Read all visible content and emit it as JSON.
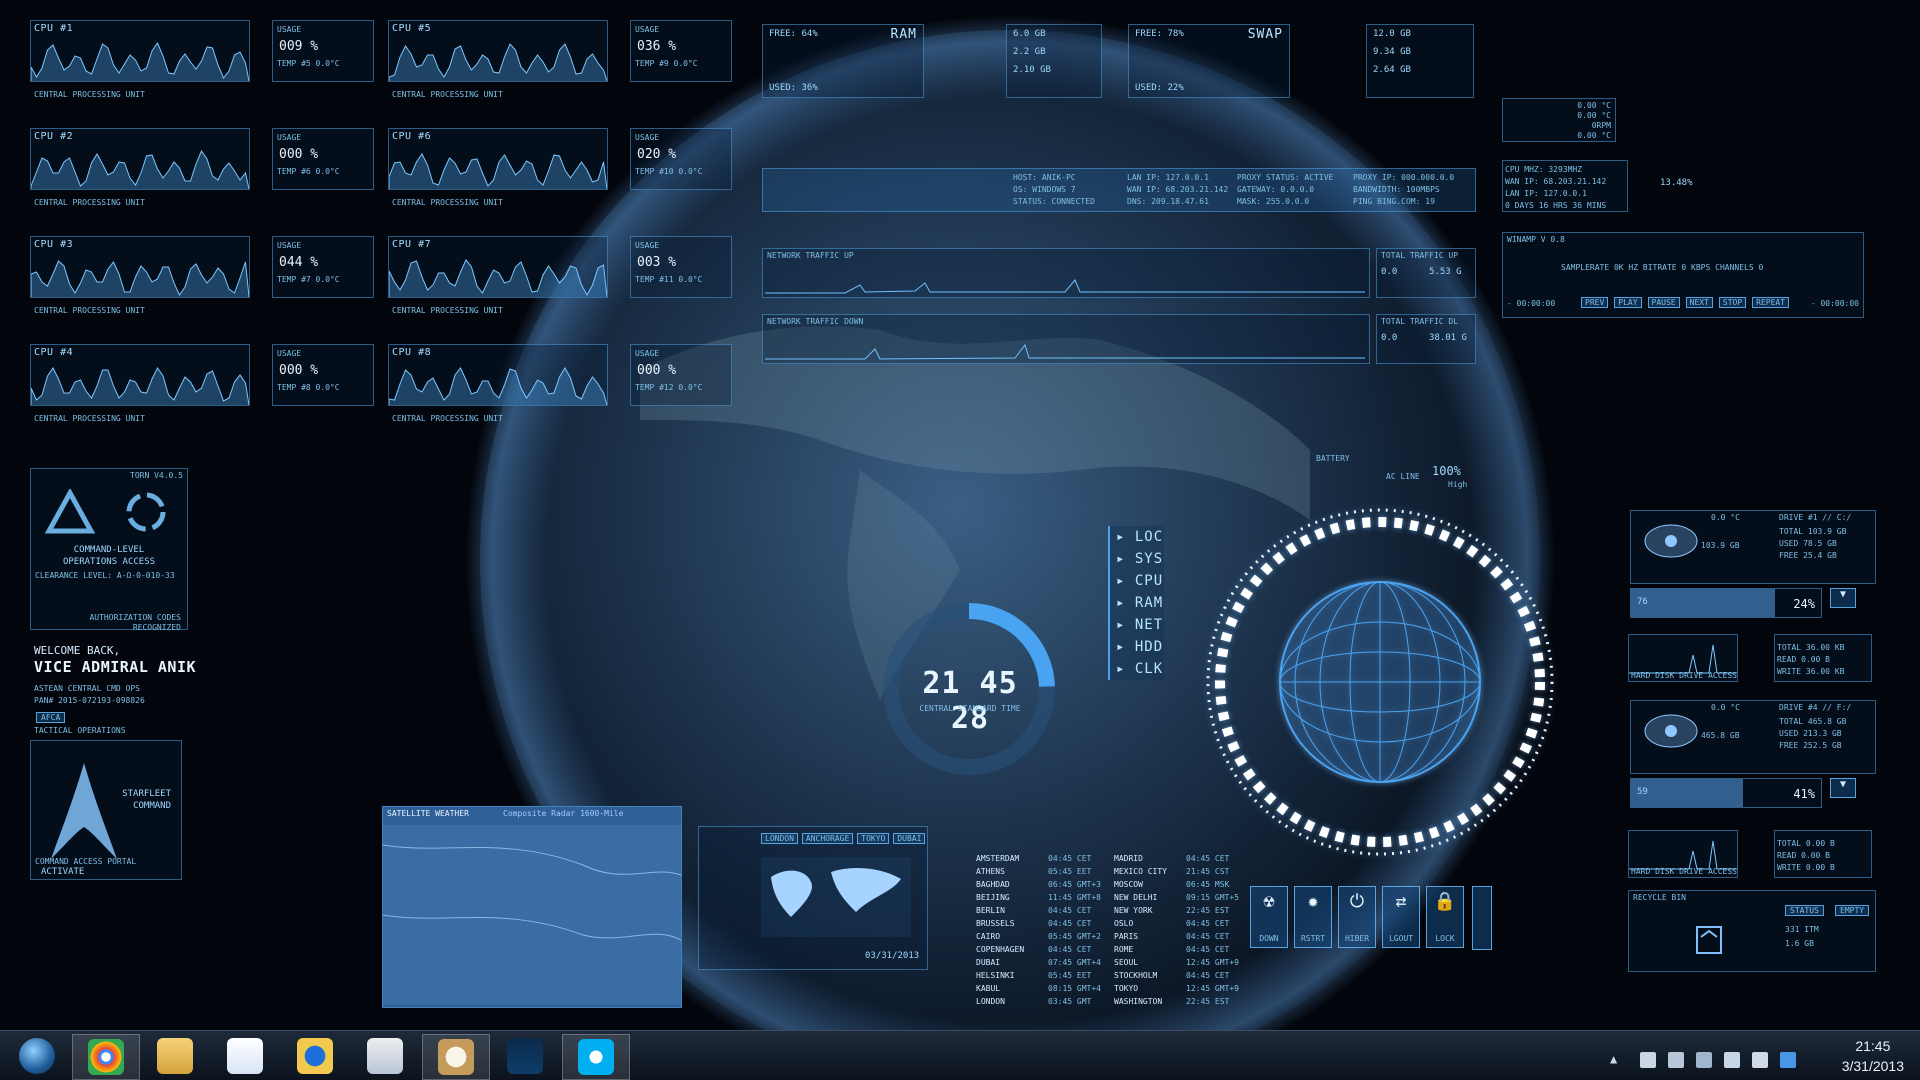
{
  "cpu_tiles": [
    {
      "title": "CPU #1",
      "usage": "009 %",
      "temp": "TEMP #5  0.0°C",
      "footer": "CENTRAL PROCESSING UNIT"
    },
    {
      "title": "CPU #5",
      "usage": "036 %",
      "temp": "TEMP #9  0.0°C",
      "footer": "CENTRAL PROCESSING UNIT"
    },
    {
      "title": "CPU #2",
      "usage": "000 %",
      "temp": "TEMP #6  0.0°C",
      "footer": "CENTRAL PROCESSING UNIT"
    },
    {
      "title": "CPU #6",
      "usage": "020 %",
      "temp": "TEMP #10 0.0°C",
      "footer": "CENTRAL PROCESSING UNIT"
    },
    {
      "title": "CPU #3",
      "usage": "044 %",
      "temp": "TEMP #7  0.0°C",
      "footer": "CENTRAL PROCESSING UNIT"
    },
    {
      "title": "CPU #7",
      "usage": "003 %",
      "temp": "TEMP #11 0.0°C",
      "footer": "CENTRAL PROCESSING UNIT"
    },
    {
      "title": "CPU #4",
      "usage": "000 %",
      "temp": "TEMP #8  0.0°C",
      "footer": "CENTRAL PROCESSING UNIT"
    },
    {
      "title": "CPU #8",
      "usage": "000 %",
      "temp": "TEMP #12 0.0°C",
      "footer": "CENTRAL PROCESSING UNIT"
    }
  ],
  "ram": {
    "title": "RAM",
    "free": "FREE: 64%",
    "used": "USED: 36%",
    "rows": [
      "6.0 GB",
      "2.2 GB",
      "2.10 GB"
    ]
  },
  "swap": {
    "title": "SWAP",
    "free": "FREE: 78%",
    "used": "USED: 22%",
    "rows": [
      "12.0 GB",
      "9.34 GB",
      "2.64 GB"
    ]
  },
  "host": {
    "col1": [
      "HOST: ANIK-PC",
      "OS: WINDOWS 7",
      "STATUS: CONNECTED"
    ],
    "col2": [
      "LAN IP: 127.0.0.1",
      "WAN IP: 68.203.21.142",
      "DNS: 209.18.47.61"
    ],
    "col3": [
      "PROXY STATUS: ACTIVE",
      "GATEWAY: 0.0.0.0",
      "MASK: 255.0.0.0"
    ],
    "col4": [
      "PROXY IP: 000.000.0.0",
      "BANDWIDTH: 100MBPS",
      "PING BING.COM: 19"
    ]
  },
  "net_up": {
    "title": "NETWORK TRAFFIC UP",
    "total_label": "TOTAL TRAFFIC UP",
    "a": "0.0",
    "b": "5.53 G"
  },
  "net_down": {
    "title": "NETWORK TRAFFIC DOWN",
    "total_label": "TOTAL TRAFFIC DL",
    "a": "0.0",
    "b": "38.01 G"
  },
  "left_panel": {
    "version": "TORN V4.0.5",
    "cmd_title": "COMMAND-LEVEL",
    "cmd_sub": "OPERATIONS ACCESS",
    "clearance": "CLEARANCE LEVEL: A-Ω-0-010-33",
    "auth1": "AUTHORIZATION CODES",
    "auth2": "RECOGNIZED",
    "welcome": "WELCOME BACK,",
    "name": "VICE ADMIRAL ANIK",
    "org": "ASTEAN CENTRAL CMD OPS",
    "pan": "PAN# 2015-072193-098826",
    "afca": "AFCA",
    "tactical": "TACTICAL OPERATIONS",
    "starfleet1": "STARFLEET",
    "starfleet2": "COMMAND",
    "portal": "COMMAND ACCESS PORTAL",
    "activate": "ACTIVATE"
  },
  "clock": {
    "time": "21 45 28",
    "zone": "CENTRAL STANDARD TIME"
  },
  "menu": [
    "LOC",
    "SYS",
    "CPU",
    "RAM",
    "NET",
    "HDD",
    "CLK"
  ],
  "battery": {
    "label": "BATTERY",
    "ac": "AC LINE",
    "pct": "100%",
    "state": "High"
  },
  "weather": {
    "title": "SATELLITE WEATHER",
    "radar": "Composite Radar 1600-Mile"
  },
  "world_clock": {
    "cities_1": [
      "AMSTERDAM",
      "ATHENS",
      "BAGHDAD",
      "BEIJING",
      "BERLIN",
      "BRUSSELS",
      "CAIRO",
      "COPENHAGEN",
      "DUBAI",
      "HELSINKI",
      "KABUL",
      "LONDON"
    ],
    "times_1": [
      "04:45 CET",
      "05:45 EET",
      "06:45 GMT+3",
      "11:45 GMT+8",
      "04:45 CET",
      "04:45 CET",
      "05:45 GMT+2",
      "04:45 CET",
      "07:45 GMT+4",
      "05:45 EET",
      "08:15 GMT+4",
      "03:45 GMT"
    ],
    "cities_2": [
      "MADRID",
      "MEXICO CITY",
      "MOSCOW",
      "NEW DELHI",
      "NEW YORK",
      "OSLO",
      "PARIS",
      "ROME",
      "SEOUL",
      "STOCKHOLM",
      "TOKYO",
      "WASHINGTON"
    ],
    "times_2": [
      "04:45 CET",
      "21:45 CST",
      "06:45 MSK",
      "09:15 GMT+5",
      "22:45 EST",
      "04:45 CET",
      "04:45 CET",
      "04:45 CET",
      "12:45 GMT+9",
      "04:45 CET",
      "12:45 GMT+9",
      "22:45 EST"
    ],
    "date": "03/31/2013",
    "tabs": [
      "LONDON",
      "ANCHORAGE",
      "TOKYO",
      "DUBAI"
    ]
  },
  "power_buttons": [
    "DOWN",
    "RSTRT",
    "HIBER",
    "LGOUT",
    "LOCK"
  ],
  "right_sys": {
    "cpu": "0.00 °C",
    "gpu": "0.00 °C",
    "fan": "0RPM",
    "hdd": "0.00 °C",
    "cpu_mhz": "CPU MHZ: 3293MHZ",
    "wan": "WAN IP: 68.203.21.142",
    "lan": "LAN IP: 127.0.0.1",
    "uptime": "0 DAYS 16 HRS 36 MINS",
    "cpu_pct": "13.48%",
    "winamp": "WINAMP V 0.8",
    "samplerate": "SAMPLERATE  0K HZ   BITRATE  0 KBPS   CHANNELS  0",
    "time_a": "- 00:00:00",
    "time_b": "- 00:00:00",
    "ctrls": [
      "PREV",
      "PLAY",
      "PAUSE",
      "NEXT",
      "STOP",
      "REPEAT"
    ]
  },
  "drives": [
    {
      "label": "DRIVE #1 // C:/",
      "total": "TOTAL 103.9 GB",
      "used": "USED 78.5 GB",
      "free": "FREE 25.4 GB",
      "bar": "76",
      "pct": "24%",
      "status": "0.0 °C",
      "size": "103.9 GB"
    },
    {
      "label": "DRIVE #4 // F:/",
      "total": "TOTAL 465.8 GB",
      "used": "USED 213.3 GB",
      "free": "FREE 252.5 GB",
      "bar": "59",
      "pct": "41%",
      "status": "0.0 °C",
      "size": "465.8 GB"
    }
  ],
  "hdd_activity": [
    {
      "title": "HARD DISK DRIVE ACCESS",
      "total": "TOTAL 36.00 KB",
      "read": "READ 0.00 B",
      "write": "WRITE 36.00 KB"
    },
    {
      "title": "HARD DISK DRIVE ACCESS",
      "total": "TOTAL 0.00 B",
      "read": "READ 0.00 B",
      "write": "WRITE 0.00 B"
    }
  ],
  "recycle": {
    "title": "RECYCLE BIN",
    "status": "STATUS",
    "empty": "EMPTY",
    "items": "331 ITM",
    "size": "1.6 GB"
  },
  "tray": {
    "time": "21:45",
    "date": "3/31/2013"
  },
  "taskbar": [
    "Start",
    "Google Chrome",
    "Windows Explorer",
    "Media Player",
    "Internet Explorer",
    "Notepad",
    "Paint",
    "Photoshop",
    "Skype"
  ],
  "colors": {
    "accent": "#5fb4ff",
    "panel": "#0a1e37",
    "bg": "#02050b",
    "taskbar": "#121a26"
  }
}
